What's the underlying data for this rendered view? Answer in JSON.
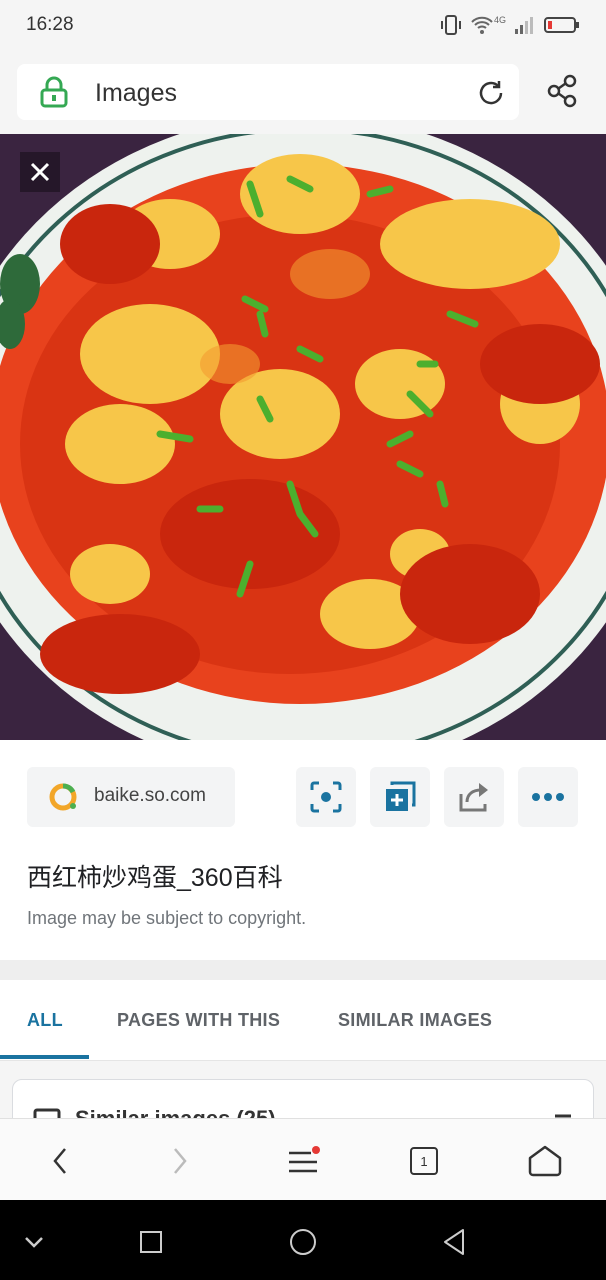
{
  "status": {
    "time": "16:28",
    "network": "4G"
  },
  "address_bar": {
    "title": "Images"
  },
  "image": {
    "alt": "西红柿炒鸡蛋"
  },
  "source": {
    "domain": "baike.so.com"
  },
  "result": {
    "title": "西红柿炒鸡蛋_360百科",
    "copyright": "Image may be subject to copyright."
  },
  "tabs": [
    {
      "label": "ALL",
      "active": true
    },
    {
      "label": "PAGES WITH THIS",
      "active": false
    },
    {
      "label": "SIMILAR IMAGES",
      "active": false
    }
  ],
  "similar": {
    "title": "Similar images (25)"
  },
  "bottom_nav": {
    "tab_count": "1"
  },
  "colors": {
    "accent": "#1a73a0",
    "notification_dot": "#e53935",
    "lock_green": "#34a853"
  }
}
